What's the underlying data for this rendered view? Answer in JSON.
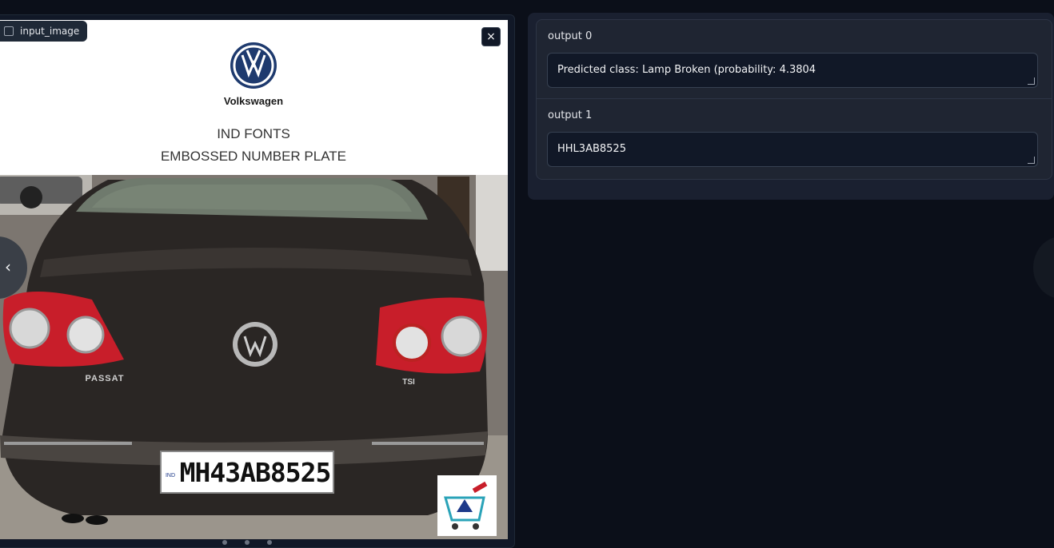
{
  "input": {
    "label": "input_image",
    "close_glyph": "×",
    "image": {
      "brand": "Volkswagen",
      "headline_line1": "IND FONTS",
      "headline_line2": "EMBOSSED NUMBER PLATE",
      "badge_left": "PASSAT",
      "badge_right": "TSI",
      "plate_country": "IND",
      "plate_number": "MH43AB8525",
      "vw_logo": "vw-logo",
      "cart_logo": "shopping-cart-logo"
    }
  },
  "nav": {
    "prev_glyph": "‹"
  },
  "outputs": [
    {
      "label": "output 0",
      "value": "Predicted class: Lamp Broken (probability: 4.3804"
    },
    {
      "label": "output 1",
      "value": "HHL3AB8525"
    }
  ],
  "colors": {
    "page_bg": "#0b0f19",
    "panel_bg": "#111827",
    "output_bg": "#1a2030",
    "textbox_bg": "#111827",
    "tail_light_red": "#c81e2a",
    "car_body": "#2a2624"
  }
}
